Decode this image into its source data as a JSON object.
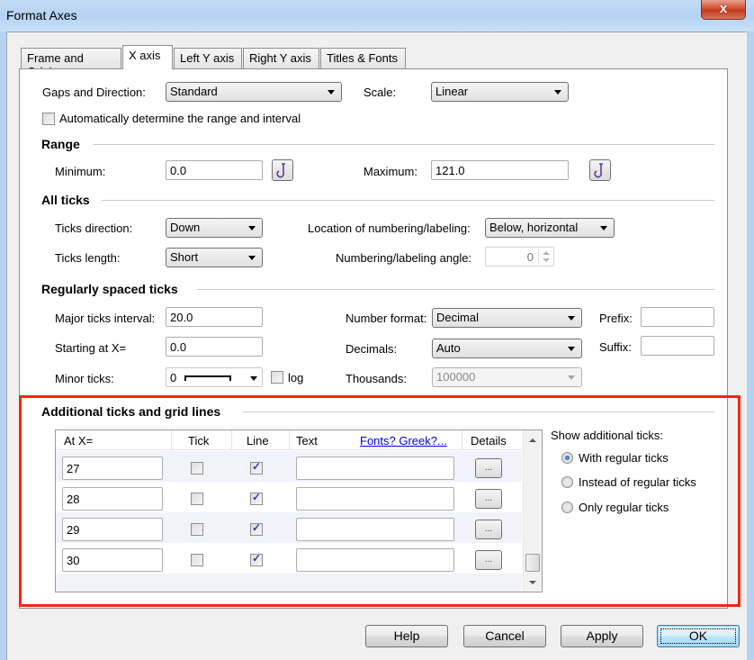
{
  "window": {
    "title": "Format Axes",
    "close_label": "x"
  },
  "tabs": [
    {
      "label": "Frame and Origin",
      "active": false
    },
    {
      "label": "X axis",
      "active": true
    },
    {
      "label": "Left Y axis",
      "active": false
    },
    {
      "label": "Right Y axis",
      "active": false
    },
    {
      "label": "Titles & Fonts",
      "active": false
    }
  ],
  "top": {
    "gaps_label": "Gaps and Direction:",
    "gaps_value": "Standard",
    "scale_label": "Scale:",
    "scale_value": "Linear",
    "auto_range_label": "Automatically determine the range and interval",
    "auto_range_checked": false
  },
  "range": {
    "heading": "Range",
    "minimum_label": "Minimum:",
    "minimum_value": "0.0",
    "maximum_label": "Maximum:",
    "maximum_value": "121.0"
  },
  "all_ticks": {
    "heading": "All ticks",
    "direction_label": "Ticks direction:",
    "direction_value": "Down",
    "length_label": "Ticks length:",
    "length_value": "Short",
    "location_label": "Location of numbering/labeling:",
    "location_value": "Below, horizontal",
    "angle_label": "Numbering/labeling angle:",
    "angle_value": "0"
  },
  "regular_ticks": {
    "heading": "Regularly spaced ticks",
    "major_label": "Major ticks interval:",
    "major_value": "20.0",
    "start_label": "Starting at X=",
    "start_value": "0.0",
    "minor_label": "Minor ticks:",
    "minor_value": "0",
    "log_label": "log",
    "log_checked": false,
    "number_format_label": "Number format:",
    "number_format_value": "Decimal",
    "decimals_label": "Decimals:",
    "decimals_value": "Auto",
    "thousands_label": "Thousands:",
    "thousands_value": "100000",
    "prefix_label": "Prefix:",
    "prefix_value": "",
    "suffix_label": "Suffix:",
    "suffix_value": ""
  },
  "additional": {
    "heading": "Additional ticks and grid lines",
    "columns": {
      "at": "At X=",
      "tick": "Tick",
      "line": "Line",
      "text": "Text",
      "fonts_link": "Fonts? Greek?...",
      "details": "Details"
    },
    "rows": [
      {
        "at": "27",
        "tick": false,
        "line": true,
        "text": "",
        "details": "..."
      },
      {
        "at": "28",
        "tick": false,
        "line": true,
        "text": "",
        "details": "..."
      },
      {
        "at": "29",
        "tick": false,
        "line": true,
        "text": "",
        "details": "..."
      },
      {
        "at": "30",
        "tick": false,
        "line": true,
        "text": "",
        "details": "..."
      }
    ],
    "show_label": "Show additional ticks:",
    "options": [
      {
        "label": "With regular ticks",
        "selected": true
      },
      {
        "label": "Instead of regular ticks",
        "selected": false
      },
      {
        "label": "Only regular ticks",
        "selected": false
      }
    ]
  },
  "buttons": {
    "help": "Help",
    "cancel": "Cancel",
    "apply": "Apply",
    "ok": "OK"
  },
  "colors": {
    "highlight_border": "#f3270c",
    "link": "#0000ee",
    "check_mark": "#2a3fa8"
  }
}
